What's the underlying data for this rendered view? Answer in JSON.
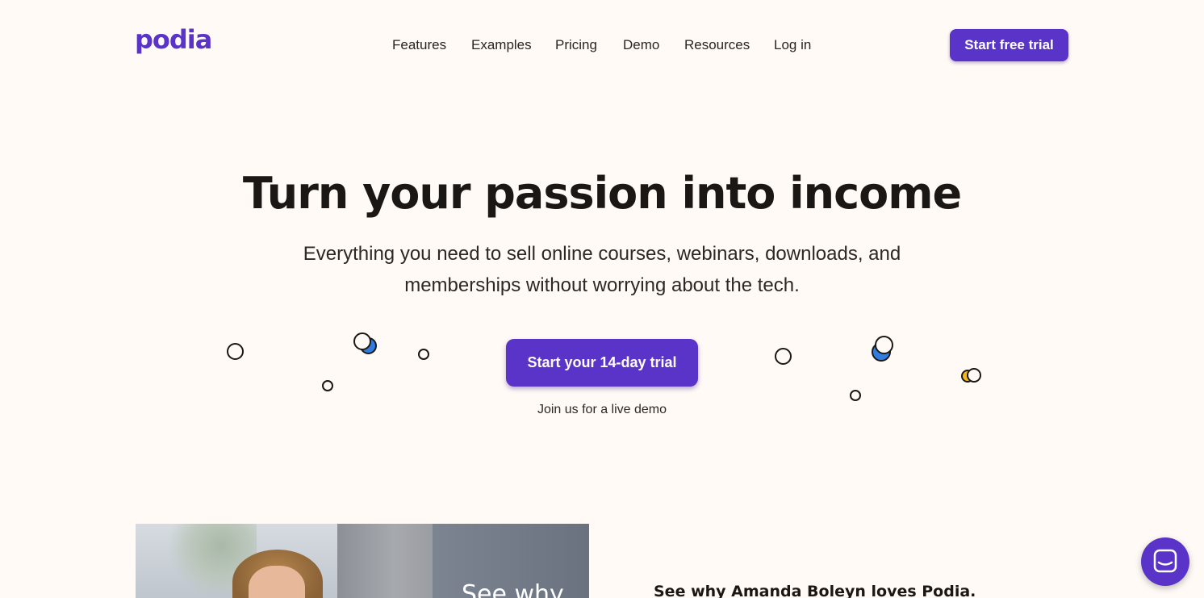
{
  "brand": {
    "logo_text": "podia",
    "accent_color": "#5a33c8"
  },
  "header": {
    "nav": [
      {
        "label": "Features"
      },
      {
        "label": "Examples"
      },
      {
        "label": "Pricing"
      },
      {
        "label": "Demo"
      },
      {
        "label": "Resources"
      },
      {
        "label": "Log in"
      }
    ],
    "cta_label": "Start free trial"
  },
  "hero": {
    "title": "Turn your passion into income",
    "subtitle": "Everything you need to sell online courses, webinars, downloads, and memberships without worrying about the tech.",
    "cta_label": "Start your 14-day trial",
    "demo_link": "Join us for a live demo"
  },
  "video": {
    "overlay_text": "See why"
  },
  "testimonial": {
    "heading": "See why Amanda Boleyn loves Podia."
  },
  "chat": {
    "icon": "chat-bubble-icon"
  },
  "colors": {
    "background": "#fffaf6",
    "blue_accent": "#2f7de1",
    "yellow_accent": "#f5b814"
  }
}
